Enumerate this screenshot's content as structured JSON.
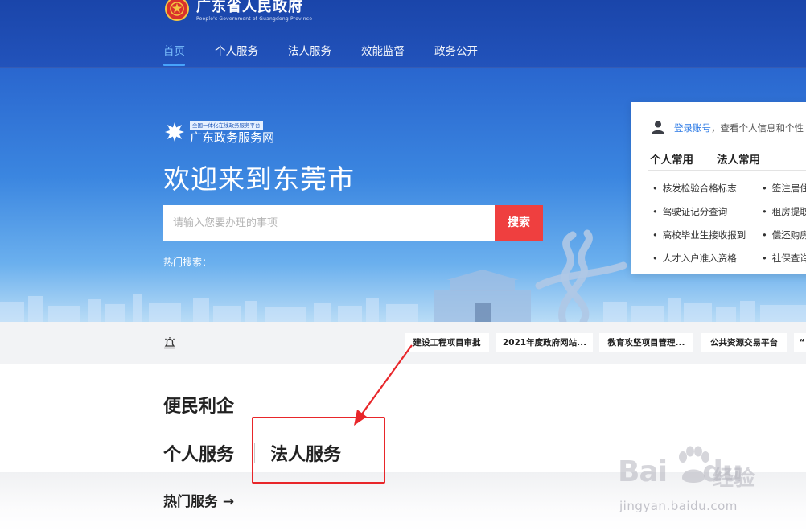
{
  "header": {
    "gov_title": "广东省人民政府",
    "gov_subtitle": "People's Government of Guangdong Province",
    "nav": [
      {
        "label": "首页",
        "active": true
      },
      {
        "label": "个人服务",
        "active": false
      },
      {
        "label": "法人服务",
        "active": false
      },
      {
        "label": "效能监督",
        "active": false
      },
      {
        "label": "政务公开",
        "active": false
      }
    ]
  },
  "hero": {
    "platform_tag": "全国一体化在线政务服务平台",
    "platform_name": "广东政务服务网",
    "welcome": "欢迎来到东莞市",
    "search_placeholder": "请输入您要办理的事项",
    "search_button": "搜索",
    "hot_search_label": "热门搜索："
  },
  "login_card": {
    "login_link": "登录账号",
    "login_rest": "，查看个人信息和个性",
    "tabs": [
      "个人常用",
      "法人常用"
    ],
    "personal_items": [
      "核发检验合格标志",
      "驾驶证记分查询",
      "高校毕业生接收报到",
      "人才入户准入资格"
    ],
    "legal_items": [
      "签注居住",
      "租房提取",
      "偿还购房",
      "社保查询"
    ]
  },
  "notice": {
    "pills": [
      "建设工程项目审批",
      "2021年度政府网站...",
      "教育攻坚项目管理...",
      "公共资源交易平台",
      "“"
    ]
  },
  "main": {
    "section_title": "便民利企",
    "tabs": [
      "个人服务",
      "法人服务"
    ],
    "hot_services": "热门服务 →"
  },
  "watermark": {
    "brand": "Bai",
    "brand2": "du",
    "jingyan": "经验",
    "url": "jingyan.baidu.com"
  },
  "colors": {
    "nav_active": "#7fc4ff",
    "search_button": "#ef3f3f",
    "annotation_red": "#e8262a",
    "login_link": "#2f7ce6"
  }
}
